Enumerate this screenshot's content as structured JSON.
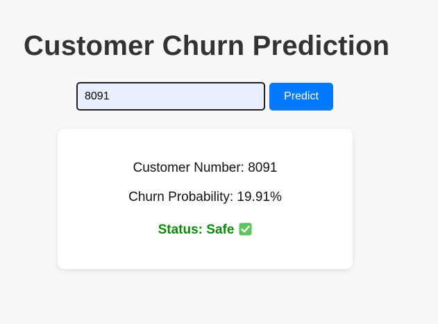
{
  "page": {
    "title": "Customer Churn Prediction"
  },
  "search": {
    "value": "8091",
    "button_label": "Predict"
  },
  "result": {
    "customer_number_text": "Customer Number: 8091",
    "churn_probability_text": "Churn Probability: 19.91%",
    "status_text": "Status: Safe",
    "status_icon": "check-mark-icon"
  },
  "colors": {
    "accent": "#007bff",
    "status_safe": "#0a8a0a",
    "input_bg": "#e8f0fe"
  }
}
